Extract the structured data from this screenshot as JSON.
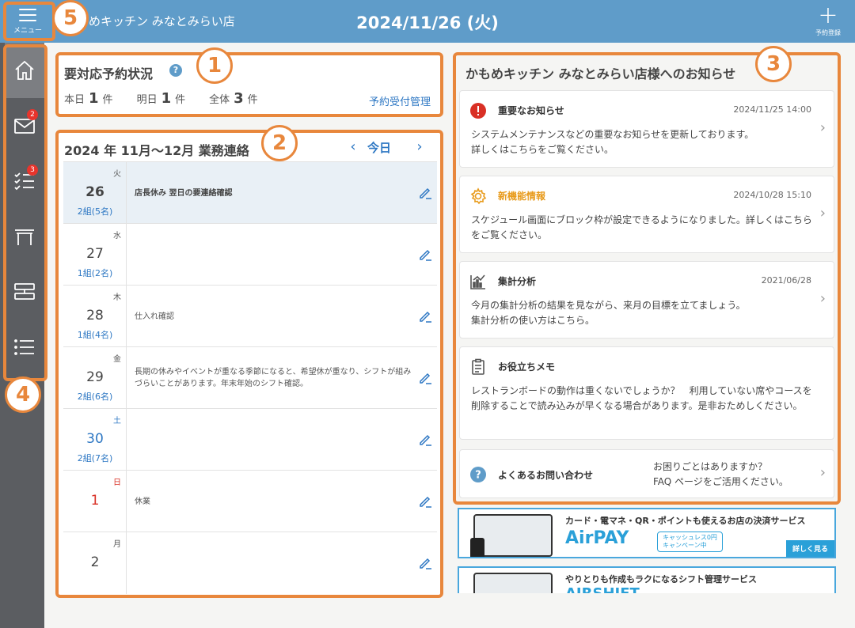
{
  "header": {
    "menu_label": "メニュー",
    "store_name": "めキッチン みなとみらい店",
    "date": "2024/11/26 (火)",
    "reserve_label": "予約登録"
  },
  "sidebar": {
    "items": [
      {
        "icon": "home-icon",
        "active": true
      },
      {
        "icon": "mail-icon",
        "badge": "2"
      },
      {
        "icon": "checklist-icon",
        "badge": "3"
      },
      {
        "icon": "table-icon"
      },
      {
        "icon": "layout-icon"
      },
      {
        "icon": "list-icon"
      }
    ]
  },
  "annotations": [
    "1",
    "2",
    "3",
    "4",
    "5"
  ],
  "reservation_status": {
    "title": "要対応予約状況",
    "help": "?",
    "today_label": "本日",
    "today_count": "1",
    "tomorrow_label": "明日",
    "tomorrow_count": "1",
    "all_label": "全体",
    "all_count": "3",
    "unit": "件",
    "link": "予約受付管理"
  },
  "business_contact": {
    "title": "2024 年 11月〜12月 業務連絡",
    "prev": "‹",
    "today": "今日",
    "next": "›",
    "days": [
      {
        "dow": "火",
        "day": "26",
        "groups": "2組(5名)",
        "note": "店長休み 翌日の要連絡確認",
        "today": true
      },
      {
        "dow": "水",
        "day": "27",
        "groups": "1組(2名)",
        "note": ""
      },
      {
        "dow": "木",
        "day": "28",
        "groups": "1組(4名)",
        "note": "仕入れ確認"
      },
      {
        "dow": "金",
        "day": "29",
        "groups": "2組(6名)",
        "note": "長期の休みやイベントが重なる季節になると、希望休が重なり、シフトが組みづらいことがあります。年末年始のシフト確認。"
      },
      {
        "dow": "土",
        "day": "30",
        "groups": "2組(7名)",
        "note": "",
        "color": "blue"
      },
      {
        "dow": "日",
        "day": "1",
        "groups": "",
        "note": "休業",
        "color": "red"
      },
      {
        "dow": "月",
        "day": "2",
        "groups": "",
        "note": ""
      }
    ]
  },
  "notices": {
    "title": "かもめキッチン みなとみらい店様へのお知らせ",
    "cards": [
      {
        "icon": "alert-icon",
        "title": "重要なお知らせ",
        "date": "2024/11/25 14:00",
        "body": "システムメンテナンスなどの重要なお知らせを更新しております。\n詳しくはこちらをご覧ください。"
      },
      {
        "icon": "gear-icon",
        "title": "新機能情報",
        "date": "2024/10/28 15:10",
        "body": "スケジュール画面にブロック枠が設定できるようになりました。詳しくはこちらをご覧ください。"
      },
      {
        "icon": "analytics-icon",
        "title": "集計分析",
        "date": "2021/06/28",
        "body": "今月の集計分析の結果を見ながら、来月の目標を立てましょう。\n集計分析の使い方はこちら。"
      },
      {
        "icon": "memo-icon",
        "title": "お役立ちメモ",
        "date": "",
        "body": "レストランボードの動作は重くないでしょうか？　利用していない席やコースを削除することで読み込みが早くなる場合があります。是非おためしください。"
      }
    ],
    "faq": {
      "title": "よくあるお問い合わせ",
      "question": "お困りごとはありますか？\nFAQ ページをご活用ください。"
    }
  },
  "banners": [
    {
      "text": "カード・電マネ・QR・ポイントも使えるお店の決済サービス",
      "logo": "AirPAY",
      "pill": "キャッシュレス0円\nキャンペーン中",
      "more": "詳しく見る"
    },
    {
      "text": "やりとりも作成もラクになるシフト管理サービス",
      "logo": "AIRSHIFT"
    }
  ]
}
